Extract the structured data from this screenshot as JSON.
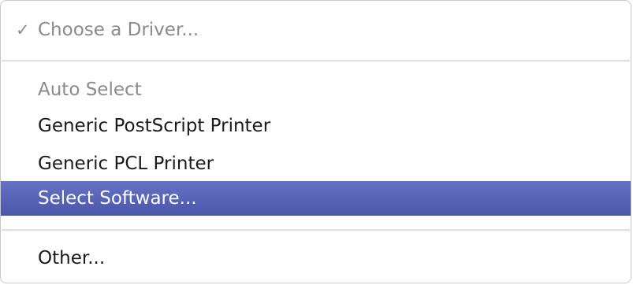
{
  "menu": {
    "items": [
      {
        "label": "Choose a Driver...",
        "checked": true,
        "state": "disabled",
        "check_mark": "✓"
      },
      {
        "label": "Auto Select",
        "checked": false,
        "state": "disabled"
      },
      {
        "label": "Generic PostScript Printer",
        "checked": false,
        "state": "enabled"
      },
      {
        "label": "Generic PCL Printer",
        "checked": false,
        "state": "enabled"
      },
      {
        "label": "Select Software...",
        "checked": false,
        "state": "highlighted"
      },
      {
        "label": "Other...",
        "checked": false,
        "state": "enabled"
      }
    ],
    "colors": {
      "highlight_top": "#6672c3",
      "highlight_bottom": "#4a56ab",
      "disabled_text": "#8a8a8a",
      "enabled_text": "#1a1a1a"
    }
  }
}
